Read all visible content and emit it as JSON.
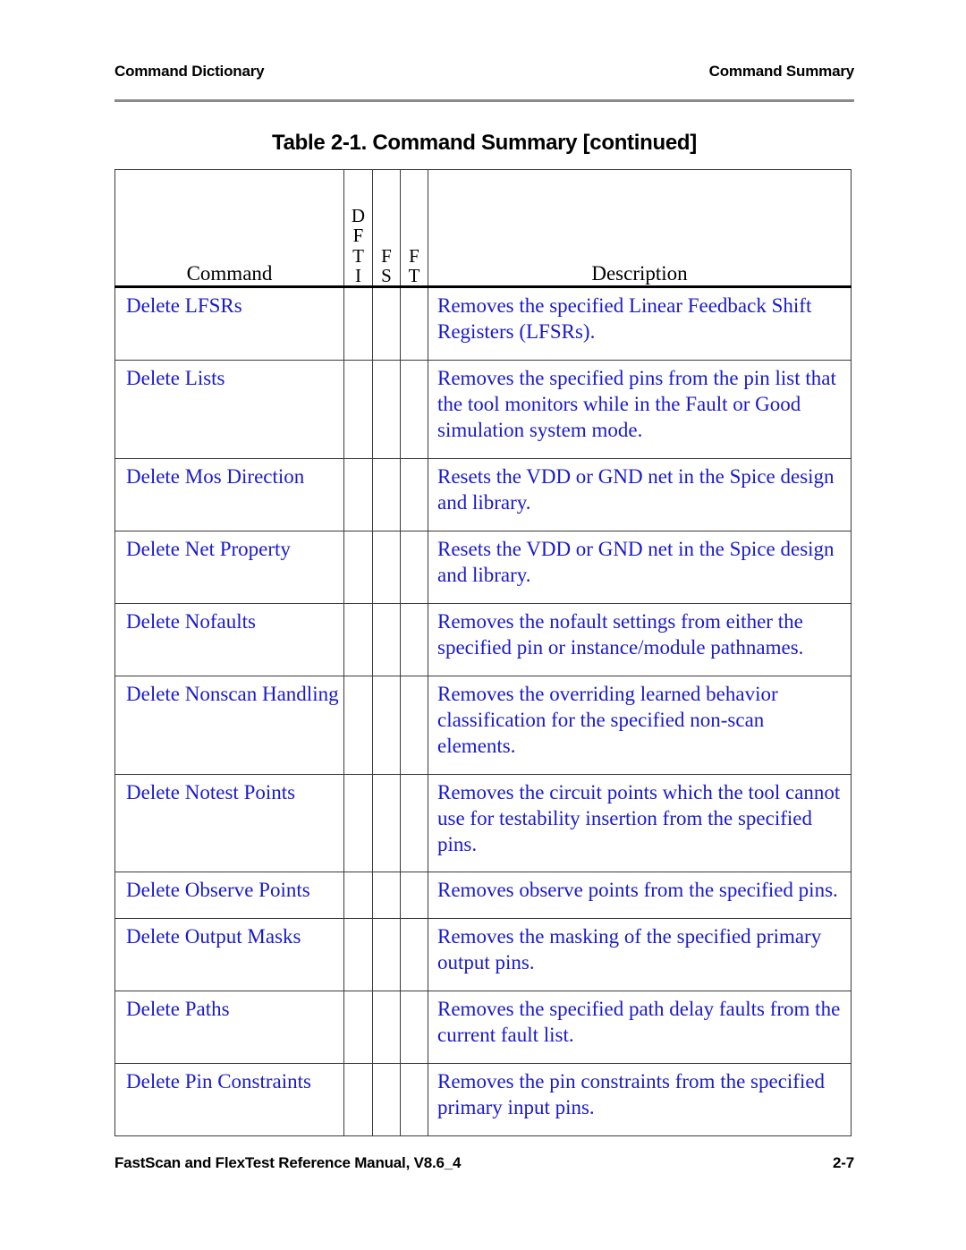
{
  "running_head": {
    "left": "Command Dictionary",
    "right": "Command Summary"
  },
  "table_title": "Table 2-1. Command Summary [continued]",
  "table": {
    "columns": {
      "command": "Command",
      "dfti": [
        "D",
        "F",
        "T",
        "I"
      ],
      "fs": [
        "F",
        "S"
      ],
      "ft": [
        "F",
        "T"
      ],
      "description": "Description"
    },
    "rows": [
      {
        "command": "Delete LFSRs",
        "dfti": "",
        "fs": "",
        "ft": "",
        "description": "Removes the specified Linear Feedback Shift Registers (LFSRs)."
      },
      {
        "command": "Delete Lists",
        "dfti": "",
        "fs": "",
        "ft": "",
        "description": "Removes the specified pins from the pin list that the tool monitors while in the Fault or Good simulation system mode."
      },
      {
        "command": "Delete Mos Direction",
        "dfti": "",
        "fs": "",
        "ft": "",
        "description": "Resets the VDD or GND net in the Spice design and library."
      },
      {
        "command": "Delete Net Property",
        "dfti": "",
        "fs": "",
        "ft": "",
        "description": "Resets the VDD or GND net in the Spice design and library."
      },
      {
        "command": "Delete Nofaults",
        "dfti": "",
        "fs": "",
        "ft": "",
        "description": "Removes the nofault settings from either the specified pin or instance/module pathnames."
      },
      {
        "command": "Delete Nonscan Handling",
        "dfti": "",
        "fs": "",
        "ft": "",
        "description": "Removes the overriding learned behavior classification for the specified non-scan elements."
      },
      {
        "command": "Delete Notest Points",
        "dfti": "",
        "fs": "",
        "ft": "",
        "description": "Removes the circuit points which the tool cannot use for testability insertion from the specified pins."
      },
      {
        "command": "Delete Observe Points",
        "dfti": "",
        "fs": "",
        "ft": "",
        "description": "Removes observe points from the specified pins."
      },
      {
        "command": "Delete Output Masks",
        "dfti": "",
        "fs": "",
        "ft": "",
        "description": "Removes the masking of the specified primary output pins."
      },
      {
        "command": "Delete Paths",
        "dfti": "",
        "fs": "",
        "ft": "",
        "description": "Removes the specified path delay faults from the current fault list."
      },
      {
        "command": "Delete Pin Constraints",
        "dfti": "",
        "fs": "",
        "ft": "",
        "description": "Removes the pin constraints from the specified primary input pins."
      }
    ]
  },
  "footer": {
    "left": "FastScan and FlexTest Reference Manual, V8.6_4",
    "right": "2-7"
  },
  "colors": {
    "text_blue": "#1a1acc",
    "text_black": "#000000",
    "rule_gray": "#8a8a8a"
  }
}
